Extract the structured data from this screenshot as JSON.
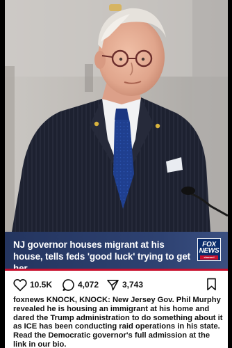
{
  "post": {
    "headline": "NJ governor houses migrant at his house, tells feds 'good luck' trying to get her",
    "logo": {
      "line1": "FOX",
      "line2": "NEWS",
      "line3": "channel"
    },
    "actions": {
      "likes": "10.5K",
      "comments": "4,072",
      "shares": "3,743"
    },
    "caption": {
      "username": "foxnews",
      "text": "KNOCK, KNOCK: New Jersey Gov. Phil Murphy revealed he is housing an immigrant at his home and dared the Trump administration to do something about it as ICE has been conducting raid operations in his state. Read the Democratic governor's full admission at the link in our bio."
    }
  },
  "icons": {
    "like": "heart-icon",
    "comment": "comment-bubble-icon",
    "share": "paper-plane-icon",
    "save": "bookmark-icon"
  },
  "colors": {
    "banner": "#2e4272",
    "accent_red": "#c8102e",
    "fox_blue": "#0a2c6b"
  }
}
